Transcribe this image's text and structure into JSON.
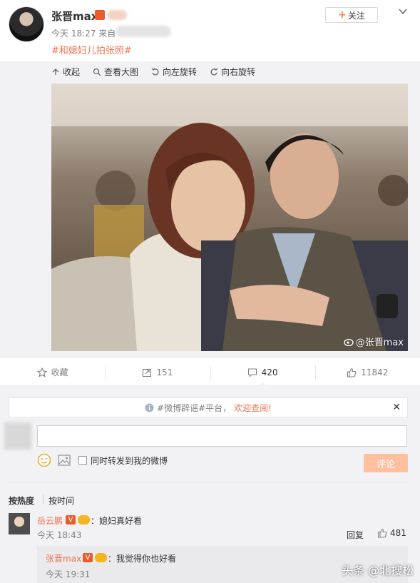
{
  "post": {
    "author": "张晋max",
    "time": "今天 18:27 来自",
    "follow_label": "关注",
    "topic": "#和媳妇儿拍张照#"
  },
  "media_toolbar": {
    "collapse": "收起",
    "view_large": "查看大图",
    "rotate_left": "向左旋转",
    "rotate_right": "向右旋转"
  },
  "photo": {
    "watermark": "@张晋max"
  },
  "actions": {
    "favorite": "收藏",
    "repost": "151",
    "comment": "420",
    "like": "11842"
  },
  "comment_box": {
    "notice_prefix": "#微博辟谣#平台，",
    "notice_link": "欢迎查阅!",
    "forward_label": "同时转发到我的微博",
    "submit_label": "评论"
  },
  "sort": {
    "hot": "按热度",
    "time": "按时间"
  },
  "comments": [
    {
      "user": "岳云鹏",
      "text": "：媳妇真好看",
      "time": "今天 18:43",
      "reply_label": "回复",
      "likes": "481"
    },
    {
      "user": "张晋max",
      "text": "：我觉得你也好看",
      "time": "今天 19:31"
    }
  ],
  "site_watermark": "头条 @北搜松",
  "colors": {
    "accent": "#eb7350",
    "submit_disabled": "#ffc09f",
    "background": "#f2f2f5"
  }
}
